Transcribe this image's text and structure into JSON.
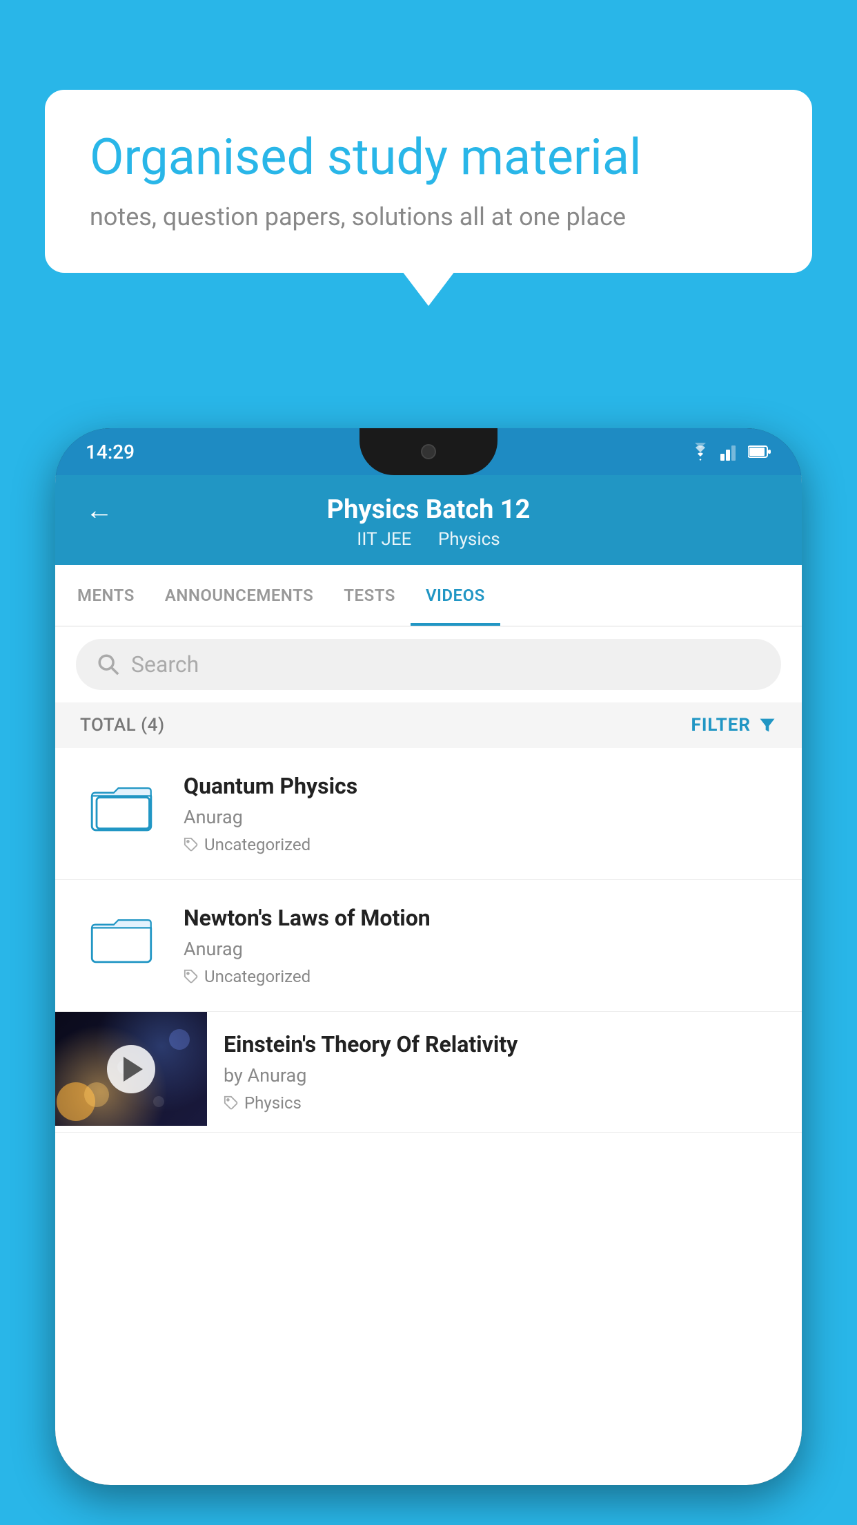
{
  "background": {
    "color": "#29b6e8"
  },
  "bubble": {
    "title": "Organised study material",
    "subtitle": "notes, question papers, solutions all at one place"
  },
  "phone": {
    "status_bar": {
      "time": "14:29"
    },
    "header": {
      "title": "Physics Batch 12",
      "subtitle_part1": "IIT JEE",
      "subtitle_part2": "Physics",
      "back_label": "←"
    },
    "tabs": [
      {
        "label": "MENTS",
        "active": false
      },
      {
        "label": "ANNOUNCEMENTS",
        "active": false
      },
      {
        "label": "TESTS",
        "active": false
      },
      {
        "label": "VIDEOS",
        "active": true
      }
    ],
    "search": {
      "placeholder": "Search"
    },
    "filter_bar": {
      "total_label": "TOTAL (4)",
      "filter_label": "FILTER"
    },
    "videos": [
      {
        "id": 1,
        "title": "Quantum Physics",
        "author": "Anurag",
        "tag": "Uncategorized",
        "type": "folder"
      },
      {
        "id": 2,
        "title": "Newton's Laws of Motion",
        "author": "Anurag",
        "tag": "Uncategorized",
        "type": "folder"
      },
      {
        "id": 3,
        "title": "Einstein's Theory Of Relativity",
        "author": "by Anurag",
        "tag": "Physics",
        "type": "video"
      }
    ]
  }
}
